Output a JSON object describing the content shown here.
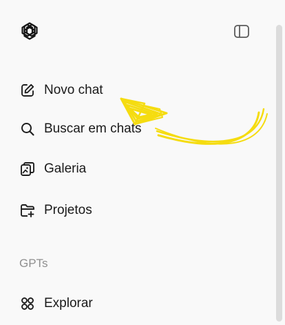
{
  "sidebar": {
    "logo_icon": "openai-logo-icon",
    "toggle_icon": "sidebar-toggle-icon",
    "items": [
      {
        "label": "Novo chat",
        "icon": "new-chat-edit-icon"
      },
      {
        "label": "Buscar em chats",
        "icon": "search-icon"
      },
      {
        "label": "Galeria",
        "icon": "gallery-icon"
      },
      {
        "label": "Projetos",
        "icon": "new-folder-icon"
      }
    ],
    "section_gpts": "GPTs",
    "gpt_items": [
      {
        "label": "Explorar",
        "icon": "explore-grid-icon"
      }
    ]
  },
  "annotation": {
    "type": "yellow-arrow",
    "color": "#f5dc10",
    "points_to": "Novo chat"
  }
}
